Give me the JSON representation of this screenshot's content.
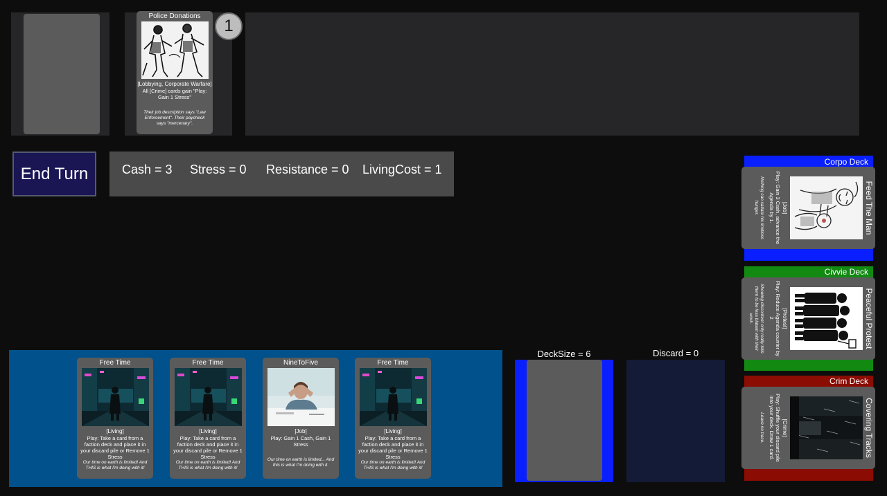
{
  "agenda": {
    "card": {
      "title": "Police Donations",
      "type": "[Lobbying, Corporate Warfare]",
      "text": "All [Crime] cards gain \"Play: Gain 1 Stress\"",
      "flavor": "Their job description says \"Law Enforcement\". Their paycheck says \"mercenary\".",
      "image": "police-sketch-image"
    },
    "counter": "1"
  },
  "controls": {
    "end_turn_label": "End Turn"
  },
  "stats": {
    "cash": "Cash = 3",
    "stress": "Stress = 0",
    "resistance": "Resistance = 0",
    "living_cost": "LivingCost = 1"
  },
  "hand": [
    {
      "title": "Free Time",
      "type": "[Living]",
      "text": "Play: Take a card from a faction deck and place it in your discard pile or Remove 1 Stress",
      "flavor": "Our time on earth is limited! And THIS is what I'm doing with it!",
      "image": "neon-alley-image"
    },
    {
      "title": "Free Time",
      "type": "[Living]",
      "text": "Play: Take a card from a faction deck and place it in your discard pile or Remove 1 Stress",
      "flavor": "Our time on earth is limited! And THIS is what I'm doing with it!",
      "image": "neon-alley-image"
    },
    {
      "title": "NineToFive",
      "type": "[Job]",
      "text": "Play: Gain 1 Cash, Gain 1 Stress",
      "flavor": "Our time on earth is limited... And this is what I'm doing with it.",
      "image": "office-worker-image"
    },
    {
      "title": "Free Time",
      "type": "[Living]",
      "text": "Play: Take a card from a faction deck and place it in your discard pile or Remove 1 Stress",
      "flavor": "Our time on earth is limited! And THIS is what I'm doing with it!",
      "image": "neon-alley-image"
    }
  ],
  "deck": {
    "size_label": "DeckSize = 6",
    "discard_label": "Discard = 0",
    "deck_color": "#0a1ffd",
    "discard_color": "#141b37"
  },
  "factions": [
    {
      "label": "Corpo Deck",
      "color": "#0a1ffd",
      "card": {
        "title": "Feed The Man",
        "type": "[Job]",
        "text": "Play: Gain 3 Cash, advance the Agenda by 1.",
        "flavor": "Nothing can satiate his limitless hunger.",
        "image": "feeding-sketch-image"
      }
    },
    {
      "label": "Civvie Deck",
      "color": "#128a12",
      "card": {
        "title": "Peaceful Protest",
        "type": "[Protest]",
        "text": "Play: Reduce Agenda counter by 2.",
        "flavor": "Showing discontent only really tells them to be less blatant with their work.",
        "image": "protest-silhouette-image"
      }
    },
    {
      "label": "Crim Deck",
      "color": "#8a0c02",
      "card": {
        "title": "Covering Tracks",
        "type": "[Crime]",
        "text": "Play: Shuffle your discard pile into your deck. Draw 1 card.",
        "flavor": "Leave no trace.",
        "image": "dark-rain-image"
      }
    }
  ]
}
